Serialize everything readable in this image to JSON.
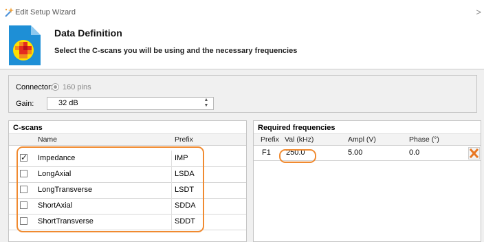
{
  "window": {
    "title": "Edit Setup Wizard",
    "close_glyph": ">"
  },
  "header": {
    "title": "Data Definition",
    "subtitle": "Select the C-scans you will be using and the necessary frequencies"
  },
  "settings": {
    "connector_label": "Connector:",
    "connector_option": "160 pins",
    "gain_label": "Gain:",
    "gain_value": "32 dB"
  },
  "cscans": {
    "title": "C-scans",
    "columns": {
      "name": "Name",
      "prefix": "Prefix"
    },
    "rows": [
      {
        "checked": true,
        "name": "Impedance",
        "prefix": "IMP"
      },
      {
        "checked": false,
        "name": "LongAxial",
        "prefix": "LSDA"
      },
      {
        "checked": false,
        "name": "LongTransverse",
        "prefix": "LSDT"
      },
      {
        "checked": false,
        "name": "ShortAxial",
        "prefix": "SDDA"
      },
      {
        "checked": false,
        "name": "ShortTransverse",
        "prefix": "SDDT"
      }
    ]
  },
  "frequencies": {
    "title": "Required frequencies",
    "columns": {
      "prefix": "Prefix",
      "val": "Val (kHz)",
      "ampl": "Ampl (V)",
      "phase": "Phase (°)"
    },
    "rows": [
      {
        "prefix": "F1",
        "val": "250.0",
        "ampl": "5.00",
        "phase": "0.0"
      }
    ]
  },
  "colors": {
    "highlight": "#f08a30",
    "delete_icon": "#e87722"
  }
}
